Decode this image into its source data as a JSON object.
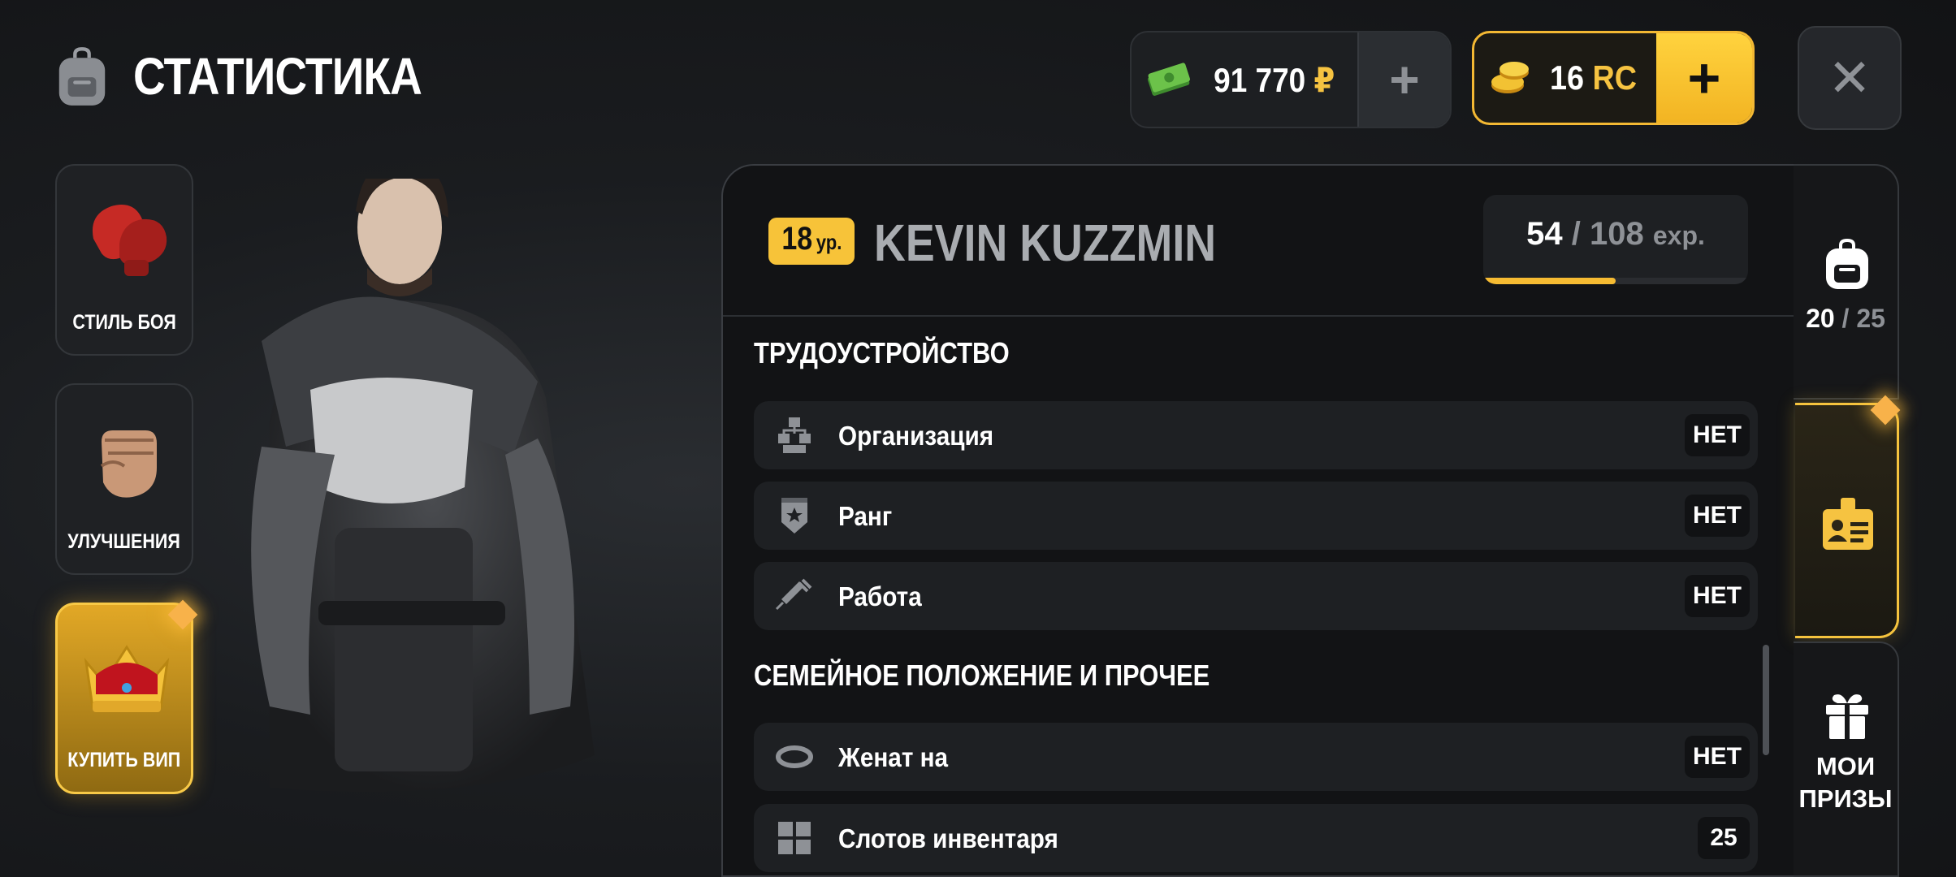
{
  "header": {
    "title": "СТАТИСТИКА",
    "title_icon": "backpack-icon"
  },
  "currency": {
    "money": {
      "amount": "91 770",
      "symbol": "₽",
      "icon": "cash-icon",
      "add_label": "+"
    },
    "rc": {
      "amount": "16",
      "symbol": "RC",
      "icon": "coins-icon",
      "add_label": "+"
    },
    "close_label": "✕"
  },
  "side_menu": {
    "fight_style": {
      "label": "СТИЛЬ БОЯ",
      "icon": "boxing-glove-icon"
    },
    "upgrades": {
      "label": "УЛУЧШЕНИЯ",
      "icon": "fist-icon"
    },
    "buy_vip": {
      "label": "КУПИТЬ ВИП",
      "icon": "crown-icon"
    }
  },
  "player": {
    "level": "18",
    "level_unit": "ур.",
    "name": "KEVIN KUZZMIN",
    "exp_current": "54",
    "exp_sep": "/",
    "exp_max": "108",
    "exp_unit": "exp.",
    "exp_fraction": 0.5
  },
  "sections": {
    "employment": {
      "title": "ТРУДОУСТРОЙСТВО",
      "rows": [
        {
          "label": "Организация",
          "value": "НЕТ",
          "icon": "organization-icon"
        },
        {
          "label": "Ранг",
          "value": "НЕТ",
          "icon": "rank-badge-icon"
        },
        {
          "label": "Работа",
          "value": "НЕТ",
          "icon": "syringe-icon"
        }
      ]
    },
    "family": {
      "title": "СЕМЕЙНОЕ ПОЛОЖЕНИЕ И ПРОЧЕЕ",
      "rows": [
        {
          "label": "Женат на",
          "value": "НЕТ",
          "icon": "ring-icon"
        },
        {
          "label": "Слотов инвентаря",
          "value": "25",
          "icon": "grid-icon"
        }
      ]
    }
  },
  "rail": {
    "inventory": {
      "current": "20",
      "sep": "/",
      "max": "25",
      "icon": "backpack-icon"
    },
    "stats_tab": {
      "icon": "id-card-icon"
    },
    "prizes": {
      "line1": "МОИ",
      "line2": "ПРИЗЫ",
      "icon": "gift-icon"
    }
  },
  "colors": {
    "accent": "#f6c341",
    "panel": "#121315",
    "row": "#1e2023"
  }
}
